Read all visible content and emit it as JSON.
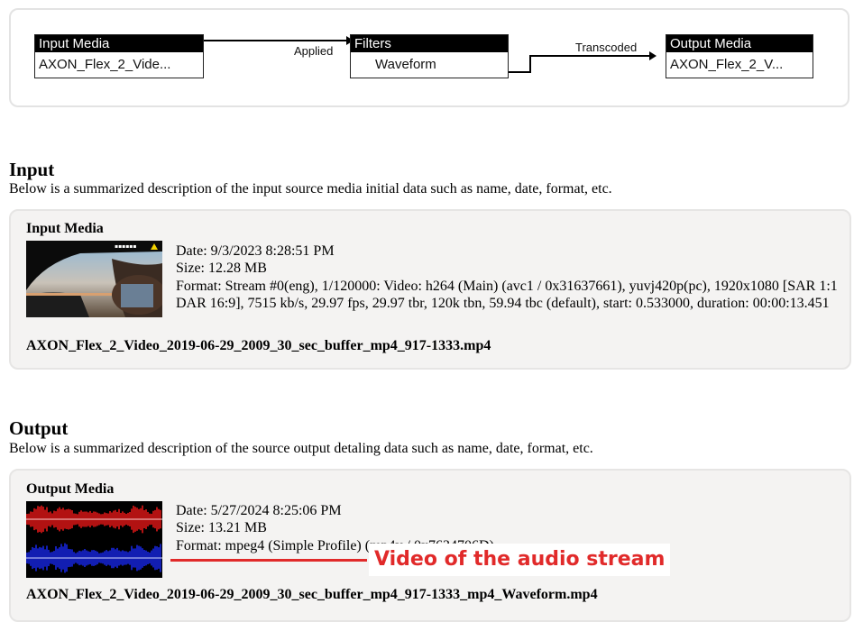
{
  "flow": {
    "nodes": [
      {
        "header": "Input Media",
        "value": "AXON_Flex_2_Vide..."
      },
      {
        "header": "Filters",
        "value": "Waveform"
      },
      {
        "header": "Output Media",
        "value": "AXON_Flex_2_V..."
      }
    ],
    "edges": [
      {
        "label": "Applied"
      },
      {
        "label": "Transcoded"
      }
    ]
  },
  "input_section": {
    "heading": "Input",
    "description": "Below is a summarized description of the input source media initial data such as name, date, format, etc.",
    "card_title": "Input Media",
    "date": "Date: 9/3/2023 8:28:51 PM",
    "size": "Size: 12.28 MB",
    "format": "Format: Stream #0(eng), 1/120000: Video: h264 (Main) (avc1 / 0x31637661), yuvj420p(pc), 1920x1080 [SAR 1:1 DAR 16:9], 7515 kb/s, 29.97 fps, 29.97 tbr, 120k tbn, 59.94 tbc (default), start: 0.533000, duration: 00:00:13.451",
    "filename": "AXON_Flex_2_Video_2019-06-29_2009_30_sec_buffer_mp4_917-1333.mp4"
  },
  "output_section": {
    "heading": "Output",
    "description": "Below is a summarized description of the source output detaling data such as name, date, format, etc.",
    "card_title": "Output Media",
    "date": "Date: 5/27/2024 8:25:06 PM",
    "size": "Size: 13.21 MB",
    "format": "Format: mpeg4 (Simple Profile) (mp4v / 0x7634706D)",
    "filename": "AXON_Flex_2_Video_2019-06-29_2009_30_sec_buffer_mp4_917-1333_mp4_Waveform.mp4"
  },
  "annotation": {
    "label": "Video of the audio stream",
    "color": "#e12a2a"
  },
  "colors": {
    "waveform_top": "#ff1a1a",
    "waveform_bottom": "#1a2bff",
    "card_bg": "#f4f3f2"
  }
}
